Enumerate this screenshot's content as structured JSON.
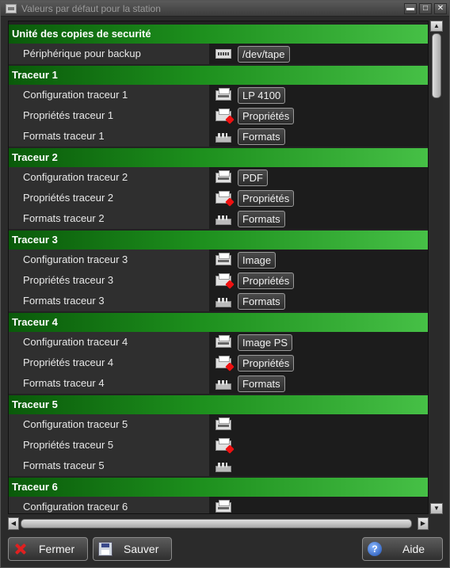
{
  "window": {
    "title": "Valeurs par défaut pour la station",
    "controls": {
      "minimize": "▬",
      "maximize": "□",
      "close": "✕"
    }
  },
  "sections": [
    {
      "title": "Unité des copies de securité",
      "rows": [
        {
          "label": "Périphérique pour backup",
          "icon": "tape-device-icon",
          "button": "/dev/tape"
        }
      ]
    },
    {
      "title": "Traceur 1",
      "rows": [
        {
          "label": "Configuration traceur 1",
          "icon": "plotter-icon",
          "button": "LP 4100"
        },
        {
          "label": "Propriétés traceur 1",
          "icon": "plotter-properties-icon",
          "button": "Propriétés"
        },
        {
          "label": "Formats traceur 1",
          "icon": "paper-formats-icon",
          "button": "Formats"
        }
      ]
    },
    {
      "title": "Traceur 2",
      "rows": [
        {
          "label": "Configuration traceur 2",
          "icon": "plotter-icon",
          "button": "PDF"
        },
        {
          "label": "Propriétés traceur 2",
          "icon": "plotter-properties-icon",
          "button": "Propriétés"
        },
        {
          "label": "Formats traceur 2",
          "icon": "paper-formats-icon",
          "button": "Formats"
        }
      ]
    },
    {
      "title": "Traceur 3",
      "rows": [
        {
          "label": "Configuration traceur 3",
          "icon": "plotter-icon",
          "button": "Image"
        },
        {
          "label": "Propriétés traceur 3",
          "icon": "plotter-properties-icon",
          "button": "Propriétés"
        },
        {
          "label": "Formats traceur 3",
          "icon": "paper-formats-icon",
          "button": "Formats"
        }
      ]
    },
    {
      "title": "Traceur 4",
      "rows": [
        {
          "label": "Configuration traceur 4",
          "icon": "plotter-icon",
          "button": "Image PS"
        },
        {
          "label": "Propriétés traceur 4",
          "icon": "plotter-properties-icon",
          "button": "Propriétés"
        },
        {
          "label": "Formats traceur 4",
          "icon": "paper-formats-icon",
          "button": "Formats"
        }
      ]
    },
    {
      "title": "Traceur 5",
      "rows": [
        {
          "label": "Configuration traceur 5",
          "icon": "plotter-icon",
          "button": ""
        },
        {
          "label": "Propriétés traceur 5",
          "icon": "plotter-properties-icon",
          "button": ""
        },
        {
          "label": "Formats traceur 5",
          "icon": "paper-formats-icon",
          "button": ""
        }
      ]
    },
    {
      "title": "Traceur 6",
      "rows": [
        {
          "label": "Configuration traceur 6",
          "icon": "plotter-icon",
          "button": ""
        }
      ]
    }
  ],
  "footer": {
    "close_label": "Fermer",
    "save_label": "Sauver",
    "help_label": "Aide",
    "help_glyph": "?"
  },
  "colors": {
    "section_gradient_start": "#0a5a0a",
    "section_gradient_end": "#46c046",
    "close_icon": "#e02020",
    "help_icon": "#1d4fb0"
  }
}
